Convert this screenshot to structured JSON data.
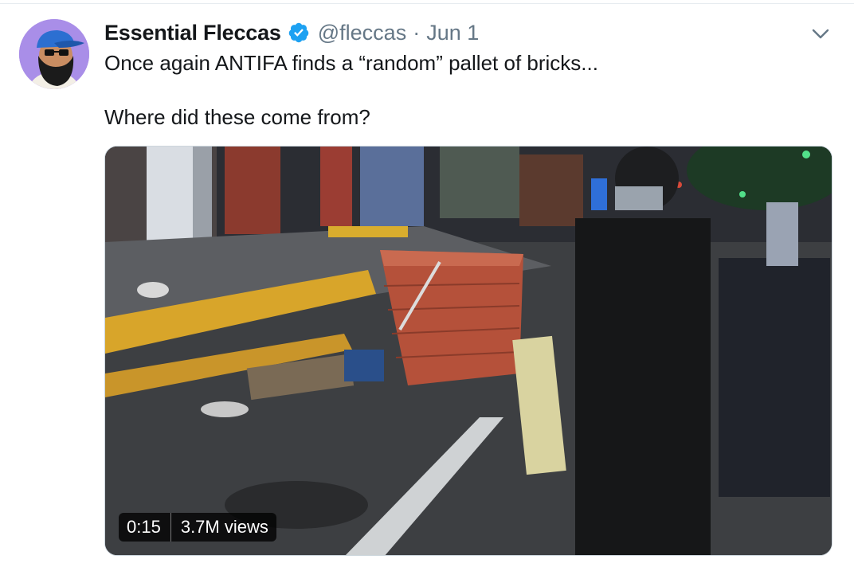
{
  "tweet": {
    "author": {
      "display_name": "Essential Fleccas",
      "handle": "@fleccas",
      "verified": true,
      "avatar_icon": "bearded-man-avatar"
    },
    "separator": "·",
    "date": "Jun 1",
    "text_lines": [
      "Once again ANTIFA finds a “random” pallet of bricks...",
      "Where did these come from?"
    ],
    "media": {
      "type": "video",
      "duration": "0:15",
      "views": "3.7M views"
    }
  },
  "colors": {
    "text_primary": "#14171a",
    "text_secondary": "#657786",
    "verified_blue": "#1da1f2",
    "divider": "#e6ecf0"
  },
  "icons": {
    "verified": "verified-badge-icon",
    "menu": "chevron-down-icon"
  }
}
